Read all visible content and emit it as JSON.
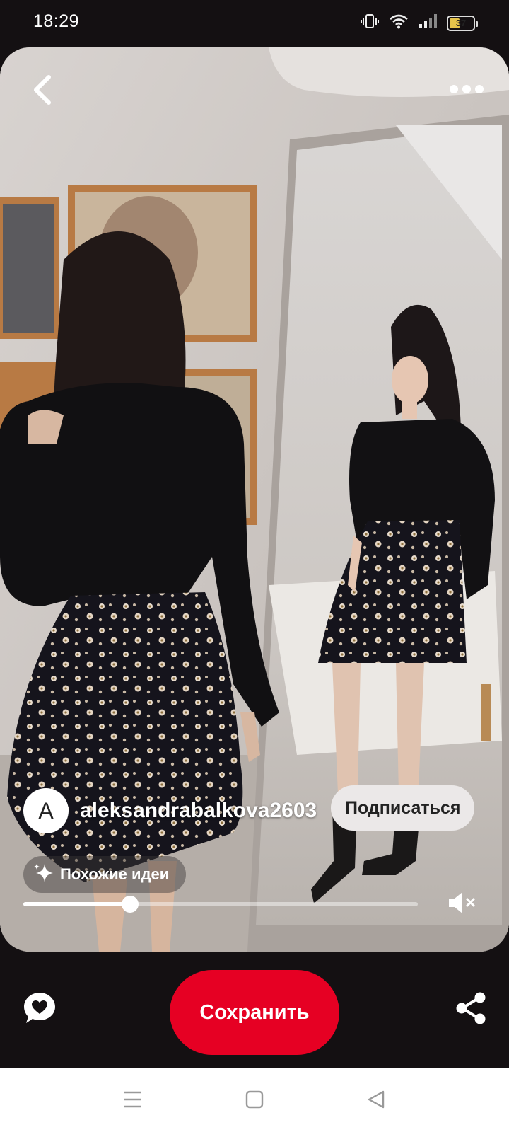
{
  "status_bar": {
    "time": "18:29",
    "battery": "37",
    "icons": [
      "vibrate-icon",
      "wifi-icon",
      "signal-icon",
      "battery-icon"
    ]
  },
  "pin": {
    "icons": [
      "back-icon",
      "more-options-icon"
    ],
    "author": {
      "avatar_letter": "A",
      "name": "aleksandrabalkova2603"
    },
    "follow_label": "Подписаться",
    "similar_ideas_label": "Похожие идеи",
    "video": {
      "progress": 0.27,
      "muted": true
    }
  },
  "actions": {
    "save_label": "Сохранить",
    "icons": [
      "reaction-heart-icon",
      "share-icon"
    ],
    "accent_color": "#e60023"
  },
  "nav_bar": {
    "icons": [
      "menu-icon",
      "home-icon",
      "back-triangle-icon"
    ]
  }
}
